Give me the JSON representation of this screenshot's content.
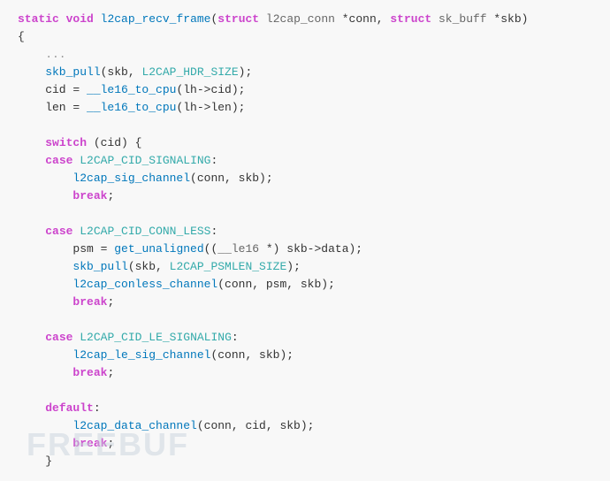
{
  "code": {
    "lines": [
      {
        "id": 1,
        "tokens": [
          {
            "text": "static",
            "cls": "kw"
          },
          {
            "text": " ",
            "cls": "plain"
          },
          {
            "text": "void",
            "cls": "kw"
          },
          {
            "text": " ",
            "cls": "plain"
          },
          {
            "text": "l2cap_recv_frame",
            "cls": "fn"
          },
          {
            "text": "(",
            "cls": "plain"
          },
          {
            "text": "struct",
            "cls": "kw"
          },
          {
            "text": " ",
            "cls": "plain"
          },
          {
            "text": "l2cap_conn",
            "cls": "type"
          },
          {
            "text": " *",
            "cls": "plain"
          },
          {
            "text": "conn",
            "cls": "var"
          },
          {
            "text": ", ",
            "cls": "plain"
          },
          {
            "text": "struct",
            "cls": "kw"
          },
          {
            "text": " ",
            "cls": "plain"
          },
          {
            "text": "sk_buff",
            "cls": "type"
          },
          {
            "text": " *",
            "cls": "plain"
          },
          {
            "text": "skb",
            "cls": "var"
          },
          {
            "text": ")",
            "cls": "plain"
          }
        ]
      },
      {
        "id": 2,
        "tokens": [
          {
            "text": "{",
            "cls": "plain"
          }
        ]
      },
      {
        "id": 3,
        "tokens": [
          {
            "text": "    ...",
            "cls": "comment"
          }
        ]
      },
      {
        "id": 4,
        "tokens": [
          {
            "text": "    skb_pull",
            "cls": "fn"
          },
          {
            "text": "(skb, ",
            "cls": "plain"
          },
          {
            "text": "L2CAP_HDR_SIZE",
            "cls": "const"
          },
          {
            "text": ");",
            "cls": "plain"
          }
        ]
      },
      {
        "id": 5,
        "tokens": [
          {
            "text": "    cid",
            "cls": "var"
          },
          {
            "text": " = ",
            "cls": "plain"
          },
          {
            "text": "__le16_to_cpu",
            "cls": "fn"
          },
          {
            "text": "(lh->cid);",
            "cls": "plain"
          }
        ]
      },
      {
        "id": 6,
        "tokens": [
          {
            "text": "    len",
            "cls": "var"
          },
          {
            "text": " = ",
            "cls": "plain"
          },
          {
            "text": "__le16_to_cpu",
            "cls": "fn"
          },
          {
            "text": "(lh->len);",
            "cls": "plain"
          }
        ]
      },
      {
        "id": 7,
        "tokens": []
      },
      {
        "id": 8,
        "tokens": [
          {
            "text": "    ",
            "cls": "plain"
          },
          {
            "text": "switch",
            "cls": "kw"
          },
          {
            "text": " (cid) {",
            "cls": "plain"
          }
        ]
      },
      {
        "id": 9,
        "tokens": [
          {
            "text": "    ",
            "cls": "plain"
          },
          {
            "text": "case",
            "cls": "case-kw"
          },
          {
            "text": " ",
            "cls": "plain"
          },
          {
            "text": "L2CAP_CID_SIGNALING",
            "cls": "const"
          },
          {
            "text": ":",
            "cls": "plain"
          }
        ]
      },
      {
        "id": 10,
        "tokens": [
          {
            "text": "        l2cap_sig_channel",
            "cls": "fn"
          },
          {
            "text": "(conn, skb);",
            "cls": "plain"
          }
        ]
      },
      {
        "id": 11,
        "tokens": [
          {
            "text": "        ",
            "cls": "plain"
          },
          {
            "text": "break",
            "cls": "break-kw"
          },
          {
            "text": ";",
            "cls": "plain"
          }
        ]
      },
      {
        "id": 12,
        "tokens": []
      },
      {
        "id": 13,
        "tokens": [
          {
            "text": "    ",
            "cls": "plain"
          },
          {
            "text": "case",
            "cls": "case-kw"
          },
          {
            "text": " ",
            "cls": "plain"
          },
          {
            "text": "L2CAP_CID_CONN_LESS",
            "cls": "const"
          },
          {
            "text": ":",
            "cls": "plain"
          }
        ]
      },
      {
        "id": 14,
        "tokens": [
          {
            "text": "        psm",
            "cls": "var"
          },
          {
            "text": " = ",
            "cls": "plain"
          },
          {
            "text": "get_unaligned",
            "cls": "fn"
          },
          {
            "text": "((",
            "cls": "plain"
          },
          {
            "text": "__le16",
            "cls": "type"
          },
          {
            "text": " *) skb->data);",
            "cls": "plain"
          }
        ]
      },
      {
        "id": 15,
        "tokens": [
          {
            "text": "        skb_pull",
            "cls": "fn"
          },
          {
            "text": "(skb, ",
            "cls": "plain"
          },
          {
            "text": "L2CAP_PSMLEN_SIZE",
            "cls": "const"
          },
          {
            "text": ");",
            "cls": "plain"
          }
        ]
      },
      {
        "id": 16,
        "tokens": [
          {
            "text": "        l2cap_conless_channel",
            "cls": "fn"
          },
          {
            "text": "(conn, psm, skb);",
            "cls": "plain"
          }
        ]
      },
      {
        "id": 17,
        "tokens": [
          {
            "text": "        ",
            "cls": "plain"
          },
          {
            "text": "break",
            "cls": "break-kw"
          },
          {
            "text": ";",
            "cls": "plain"
          }
        ]
      },
      {
        "id": 18,
        "tokens": []
      },
      {
        "id": 19,
        "tokens": [
          {
            "text": "    ",
            "cls": "plain"
          },
          {
            "text": "case",
            "cls": "case-kw"
          },
          {
            "text": " ",
            "cls": "plain"
          },
          {
            "text": "L2CAP_CID_LE_SIGNALING",
            "cls": "const"
          },
          {
            "text": ":",
            "cls": "plain"
          }
        ]
      },
      {
        "id": 20,
        "tokens": [
          {
            "text": "        l2cap_le_sig_channel",
            "cls": "fn"
          },
          {
            "text": "(conn, skb);",
            "cls": "plain"
          }
        ]
      },
      {
        "id": 21,
        "tokens": [
          {
            "text": "        ",
            "cls": "plain"
          },
          {
            "text": "break",
            "cls": "break-kw"
          },
          {
            "text": ";",
            "cls": "plain"
          }
        ]
      },
      {
        "id": 22,
        "tokens": []
      },
      {
        "id": 23,
        "tokens": [
          {
            "text": "    ",
            "cls": "plain"
          },
          {
            "text": "default",
            "cls": "default-kw"
          },
          {
            "text": ":",
            "cls": "plain"
          }
        ]
      },
      {
        "id": 24,
        "tokens": [
          {
            "text": "        l2cap_data_channel",
            "cls": "fn"
          },
          {
            "text": "(conn, cid, skb);",
            "cls": "plain"
          }
        ]
      },
      {
        "id": 25,
        "tokens": [
          {
            "text": "        ",
            "cls": "plain"
          },
          {
            "text": "break",
            "cls": "break-kw"
          },
          {
            "text": ";",
            "cls": "plain"
          }
        ]
      },
      {
        "id": 26,
        "tokens": [
          {
            "text": "    }",
            "cls": "plain"
          }
        ]
      }
    ]
  },
  "watermark": "FREEBUF"
}
